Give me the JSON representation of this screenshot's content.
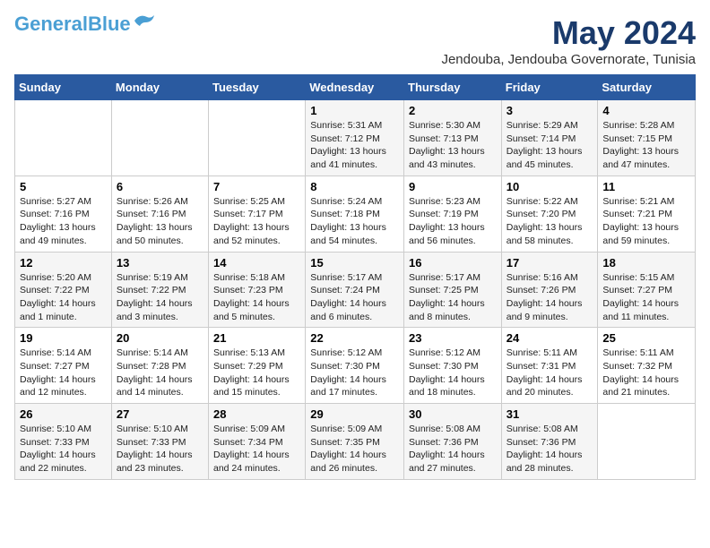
{
  "logo": {
    "line1": "General",
    "line2": "Blue"
  },
  "title": "May 2024",
  "location": "Jendouba, Jendouba Governorate, Tunisia",
  "days_header": [
    "Sunday",
    "Monday",
    "Tuesday",
    "Wednesday",
    "Thursday",
    "Friday",
    "Saturday"
  ],
  "weeks": [
    [
      {
        "day": "",
        "detail": ""
      },
      {
        "day": "",
        "detail": ""
      },
      {
        "day": "",
        "detail": ""
      },
      {
        "day": "1",
        "detail": "Sunrise: 5:31 AM\nSunset: 7:12 PM\nDaylight: 13 hours\nand 41 minutes."
      },
      {
        "day": "2",
        "detail": "Sunrise: 5:30 AM\nSunset: 7:13 PM\nDaylight: 13 hours\nand 43 minutes."
      },
      {
        "day": "3",
        "detail": "Sunrise: 5:29 AM\nSunset: 7:14 PM\nDaylight: 13 hours\nand 45 minutes."
      },
      {
        "day": "4",
        "detail": "Sunrise: 5:28 AM\nSunset: 7:15 PM\nDaylight: 13 hours\nand 47 minutes."
      }
    ],
    [
      {
        "day": "5",
        "detail": "Sunrise: 5:27 AM\nSunset: 7:16 PM\nDaylight: 13 hours\nand 49 minutes."
      },
      {
        "day": "6",
        "detail": "Sunrise: 5:26 AM\nSunset: 7:16 PM\nDaylight: 13 hours\nand 50 minutes."
      },
      {
        "day": "7",
        "detail": "Sunrise: 5:25 AM\nSunset: 7:17 PM\nDaylight: 13 hours\nand 52 minutes."
      },
      {
        "day": "8",
        "detail": "Sunrise: 5:24 AM\nSunset: 7:18 PM\nDaylight: 13 hours\nand 54 minutes."
      },
      {
        "day": "9",
        "detail": "Sunrise: 5:23 AM\nSunset: 7:19 PM\nDaylight: 13 hours\nand 56 minutes."
      },
      {
        "day": "10",
        "detail": "Sunrise: 5:22 AM\nSunset: 7:20 PM\nDaylight: 13 hours\nand 58 minutes."
      },
      {
        "day": "11",
        "detail": "Sunrise: 5:21 AM\nSunset: 7:21 PM\nDaylight: 13 hours\nand 59 minutes."
      }
    ],
    [
      {
        "day": "12",
        "detail": "Sunrise: 5:20 AM\nSunset: 7:22 PM\nDaylight: 14 hours\nand 1 minute."
      },
      {
        "day": "13",
        "detail": "Sunrise: 5:19 AM\nSunset: 7:22 PM\nDaylight: 14 hours\nand 3 minutes."
      },
      {
        "day": "14",
        "detail": "Sunrise: 5:18 AM\nSunset: 7:23 PM\nDaylight: 14 hours\nand 5 minutes."
      },
      {
        "day": "15",
        "detail": "Sunrise: 5:17 AM\nSunset: 7:24 PM\nDaylight: 14 hours\nand 6 minutes."
      },
      {
        "day": "16",
        "detail": "Sunrise: 5:17 AM\nSunset: 7:25 PM\nDaylight: 14 hours\nand 8 minutes."
      },
      {
        "day": "17",
        "detail": "Sunrise: 5:16 AM\nSunset: 7:26 PM\nDaylight: 14 hours\nand 9 minutes."
      },
      {
        "day": "18",
        "detail": "Sunrise: 5:15 AM\nSunset: 7:27 PM\nDaylight: 14 hours\nand 11 minutes."
      }
    ],
    [
      {
        "day": "19",
        "detail": "Sunrise: 5:14 AM\nSunset: 7:27 PM\nDaylight: 14 hours\nand 12 minutes."
      },
      {
        "day": "20",
        "detail": "Sunrise: 5:14 AM\nSunset: 7:28 PM\nDaylight: 14 hours\nand 14 minutes."
      },
      {
        "day": "21",
        "detail": "Sunrise: 5:13 AM\nSunset: 7:29 PM\nDaylight: 14 hours\nand 15 minutes."
      },
      {
        "day": "22",
        "detail": "Sunrise: 5:12 AM\nSunset: 7:30 PM\nDaylight: 14 hours\nand 17 minutes."
      },
      {
        "day": "23",
        "detail": "Sunrise: 5:12 AM\nSunset: 7:30 PM\nDaylight: 14 hours\nand 18 minutes."
      },
      {
        "day": "24",
        "detail": "Sunrise: 5:11 AM\nSunset: 7:31 PM\nDaylight: 14 hours\nand 20 minutes."
      },
      {
        "day": "25",
        "detail": "Sunrise: 5:11 AM\nSunset: 7:32 PM\nDaylight: 14 hours\nand 21 minutes."
      }
    ],
    [
      {
        "day": "26",
        "detail": "Sunrise: 5:10 AM\nSunset: 7:33 PM\nDaylight: 14 hours\nand 22 minutes."
      },
      {
        "day": "27",
        "detail": "Sunrise: 5:10 AM\nSunset: 7:33 PM\nDaylight: 14 hours\nand 23 minutes."
      },
      {
        "day": "28",
        "detail": "Sunrise: 5:09 AM\nSunset: 7:34 PM\nDaylight: 14 hours\nand 24 minutes."
      },
      {
        "day": "29",
        "detail": "Sunrise: 5:09 AM\nSunset: 7:35 PM\nDaylight: 14 hours\nand 26 minutes."
      },
      {
        "day": "30",
        "detail": "Sunrise: 5:08 AM\nSunset: 7:36 PM\nDaylight: 14 hours\nand 27 minutes."
      },
      {
        "day": "31",
        "detail": "Sunrise: 5:08 AM\nSunset: 7:36 PM\nDaylight: 14 hours\nand 28 minutes."
      },
      {
        "day": "",
        "detail": ""
      }
    ]
  ]
}
